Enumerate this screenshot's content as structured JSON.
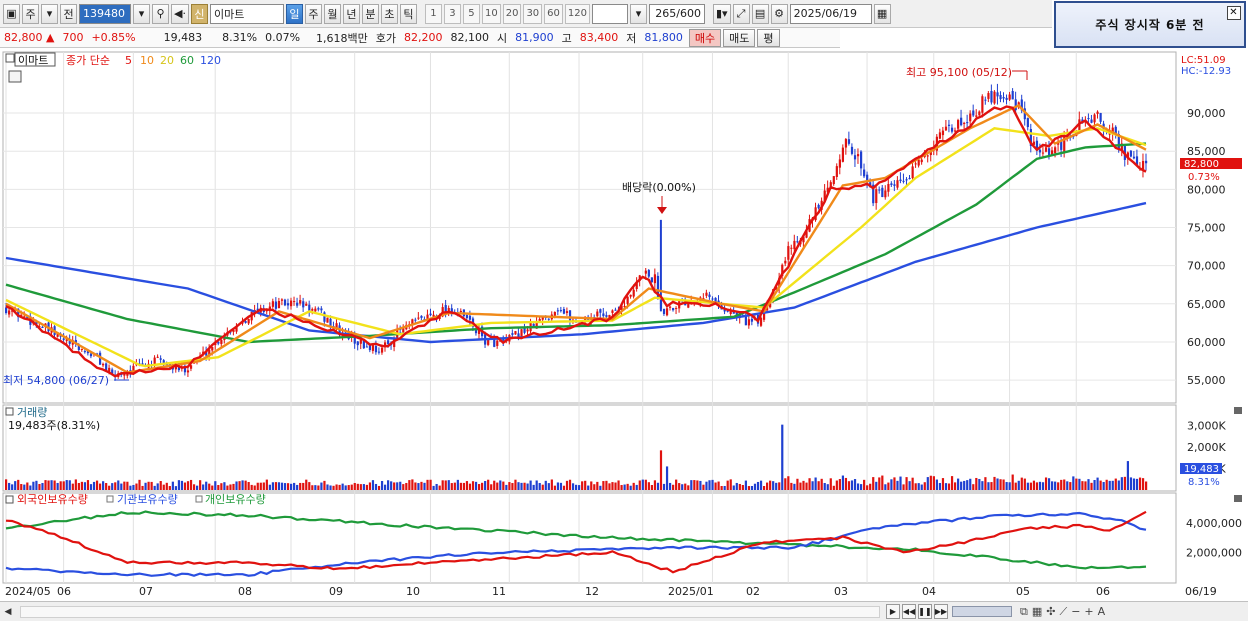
{
  "toolbar": {
    "cycle_label": "주",
    "prev_label": "전",
    "code": "139480",
    "name": "이마트",
    "sin_label": "신",
    "periods": [
      "일",
      "주",
      "월",
      "년",
      "분",
      "초",
      "틱"
    ],
    "active_period": "일",
    "intervals": [
      "1",
      "3",
      "5",
      "10",
      "20",
      "30",
      "60",
      "120"
    ],
    "count": "265/600",
    "date": "2025/06/19"
  },
  "notice": {
    "text": "주식 장시작 6분 전"
  },
  "info": {
    "price": "82,800",
    "change": "700",
    "change_pct": "+0.85%",
    "volume": "19,483",
    "turnover": "8.31%",
    "vol_pct": "0.07%",
    "amount": "1,618백만",
    "quote_label": "호가",
    "ask": "82,200",
    "bid": "82,100",
    "open_label": "시",
    "open": "81,900",
    "high_label": "고",
    "high": "83,400",
    "low_label": "저",
    "low": "81,800",
    "buy_label": "매수",
    "sell_label": "매도",
    "extra_label": "평"
  },
  "price_panel": {
    "name": "이마트",
    "legend_main": "종가 단순",
    "ma_periods": [
      "5",
      "10",
      "20",
      "60",
      "120"
    ],
    "lc_label": "LC:51.09",
    "hc_label": "HC:-12.93",
    "high_annotation": "최고 95,100 (05/12)",
    "low_annotation": "최저 54,800 (06/27)",
    "div_annotation": "배당락(0.00%)",
    "price_tag": "82,800",
    "price_tag_pct": "0.73%"
  },
  "volume_panel": {
    "title": "거래량",
    "value_label": "19,483주(8.31%)",
    "tag": "19,483",
    "tag_pct": "8.31%"
  },
  "holdings_panel": {
    "series": [
      "외국인보유수량",
      "기관보유수량",
      "개인보유수량"
    ]
  },
  "x_axis": {
    "labels": [
      "2024/05",
      "06",
      "07",
      "08",
      "09",
      "10",
      "11",
      "12",
      "2025/01",
      "02",
      "03",
      "04",
      "05",
      "06"
    ],
    "right_label": "06/19"
  },
  "chart_data": [
    {
      "type": "candlestick",
      "title": "이마트",
      "series_names": [
        "5",
        "10",
        "20",
        "60",
        "120"
      ],
      "ylim": [
        52000,
        98000
      ],
      "yticks": [
        55000,
        60000,
        65000,
        70000,
        75000,
        80000,
        85000,
        90000
      ],
      "keypoints": [
        [
          0,
          64500
        ],
        [
          10,
          62500
        ],
        [
          20,
          60000
        ],
        [
          30,
          58000
        ],
        [
          35,
          55500
        ],
        [
          42,
          56500
        ],
        [
          50,
          57500
        ],
        [
          58,
          56300
        ],
        [
          64,
          58000
        ],
        [
          72,
          61000
        ],
        [
          80,
          63500
        ],
        [
          88,
          64800
        ],
        [
          96,
          65200
        ],
        [
          104,
          63500
        ],
        [
          110,
          61500
        ],
        [
          118,
          59500
        ],
        [
          124,
          59000
        ],
        [
          130,
          61500
        ],
        [
          138,
          63200
        ],
        [
          146,
          64500
        ],
        [
          152,
          63000
        ],
        [
          158,
          60200
        ],
        [
          164,
          59800
        ],
        [
          170,
          61300
        ],
        [
          176,
          62700
        ],
        [
          182,
          64500
        ],
        [
          188,
          62500
        ],
        [
          194,
          63500
        ],
        [
          200,
          63800
        ],
        [
          206,
          65800
        ],
        [
          210,
          69200
        ],
        [
          214,
          68200
        ],
        [
          216,
          64200
        ],
        [
          224,
          65400
        ],
        [
          230,
          66400
        ],
        [
          236,
          64600
        ],
        [
          244,
          62800
        ],
        [
          248,
          62500
        ],
        [
          252,
          66000
        ],
        [
          258,
          72000
        ],
        [
          266,
          76200
        ],
        [
          272,
          80500
        ],
        [
          276,
          86200
        ],
        [
          282,
          83500
        ],
        [
          286,
          79000
        ],
        [
          292,
          80000
        ],
        [
          298,
          81500
        ],
        [
          304,
          85300
        ],
        [
          310,
          87300
        ],
        [
          318,
          89800
        ],
        [
          326,
          92700
        ],
        [
          331,
          92300
        ],
        [
          334,
          90800
        ],
        [
          340,
          84500
        ],
        [
          346,
          84800
        ],
        [
          352,
          87500
        ],
        [
          356,
          89300
        ],
        [
          360,
          89300
        ],
        [
          366,
          86800
        ],
        [
          370,
          84000
        ],
        [
          376,
          82800
        ]
      ],
      "ma5": [
        [
          0,
          64800
        ],
        [
          35,
          55500
        ],
        [
          60,
          57000
        ],
        [
          85,
          64500
        ],
        [
          110,
          61200
        ],
        [
          124,
          59200
        ],
        [
          146,
          64200
        ],
        [
          164,
          60000
        ],
        [
          200,
          63200
        ],
        [
          210,
          68800
        ],
        [
          218,
          65000
        ],
        [
          236,
          64800
        ],
        [
          248,
          63000
        ],
        [
          272,
          80000
        ],
        [
          286,
          80500
        ],
        [
          310,
          86500
        ],
        [
          331,
          91500
        ],
        [
          340,
          85000
        ],
        [
          356,
          88800
        ],
        [
          376,
          82500
        ]
      ],
      "ma10": [
        [
          0,
          65000
        ],
        [
          40,
          56000
        ],
        [
          64,
          57500
        ],
        [
          90,
          64000
        ],
        [
          120,
          60500
        ],
        [
          146,
          63800
        ],
        [
          200,
          63000
        ],
        [
          212,
          67000
        ],
        [
          236,
          65000
        ],
        [
          250,
          64000
        ],
        [
          276,
          80500
        ],
        [
          290,
          81500
        ],
        [
          318,
          88000
        ],
        [
          334,
          91000
        ],
        [
          346,
          86000
        ],
        [
          360,
          88500
        ],
        [
          376,
          85200
        ]
      ],
      "ma20": [
        [
          0,
          65500
        ],
        [
          45,
          56800
        ],
        [
          70,
          58000
        ],
        [
          100,
          64000
        ],
        [
          130,
          61000
        ],
        [
          160,
          62500
        ],
        [
          200,
          62800
        ],
        [
          214,
          65800
        ],
        [
          250,
          64500
        ],
        [
          282,
          75000
        ],
        [
          300,
          81500
        ],
        [
          326,
          88000
        ],
        [
          344,
          87000
        ],
        [
          360,
          88000
        ],
        [
          376,
          85800
        ]
      ],
      "ma60": [
        [
          0,
          67500
        ],
        [
          40,
          63000
        ],
        [
          80,
          60000
        ],
        [
          120,
          60800
        ],
        [
          160,
          61800
        ],
        [
          200,
          62200
        ],
        [
          240,
          63300
        ],
        [
          260,
          66500
        ],
        [
          290,
          71500
        ],
        [
          320,
          78000
        ],
        [
          340,
          84000
        ],
        [
          356,
          85500
        ],
        [
          376,
          86000
        ]
      ],
      "ma120": [
        [
          0,
          71000
        ],
        [
          60,
          67000
        ],
        [
          100,
          61500
        ],
        [
          140,
          60000
        ],
        [
          190,
          61000
        ],
        [
          230,
          62500
        ],
        [
          260,
          64500
        ],
        [
          300,
          70500
        ],
        [
          340,
          75000
        ],
        [
          376,
          78200
        ]
      ]
    },
    {
      "type": "bar",
      "title": "거래량",
      "ylim": [
        0,
        3500
      ],
      "yticks": [
        1000,
        2000,
        3000
      ],
      "spikes": [
        [
          216,
          1850
        ],
        [
          218,
          1100
        ],
        [
          256,
          3050
        ],
        [
          370,
          1350
        ]
      ]
    },
    {
      "type": "line",
      "series_names": [
        "외국인보유수량",
        "기관보유수량",
        "개인보유수량"
      ],
      "ylim": [
        0,
        5200000
      ],
      "yticks": [
        2000000,
        4000000
      ],
      "foreign": [
        [
          0,
          4200000
        ],
        [
          15,
          3300000
        ],
        [
          40,
          1300000
        ],
        [
          80,
          1300000
        ],
        [
          110,
          900000
        ],
        [
          140,
          1300000
        ],
        [
          200,
          2000000
        ],
        [
          220,
          700000
        ],
        [
          250,
          2700000
        ],
        [
          276,
          3000000
        ],
        [
          296,
          2000000
        ],
        [
          316,
          2700000
        ],
        [
          336,
          3600000
        ],
        [
          356,
          3800000
        ],
        [
          364,
          3500000
        ],
        [
          376,
          4700000
        ]
      ],
      "institution": [
        [
          0,
          900000
        ],
        [
          40,
          500000
        ],
        [
          80,
          500000
        ],
        [
          120,
          1400000
        ],
        [
          160,
          2000000
        ],
        [
          220,
          2300000
        ],
        [
          260,
          2300000
        ],
        [
          290,
          3800000
        ],
        [
          330,
          4500000
        ],
        [
          356,
          4600000
        ],
        [
          370,
          4000000
        ],
        [
          376,
          3500000
        ]
      ],
      "individual": [
        [
          0,
          3600000
        ],
        [
          40,
          4700000
        ],
        [
          80,
          4500000
        ],
        [
          140,
          3700000
        ],
        [
          200,
          3000000
        ],
        [
          250,
          2600000
        ],
        [
          300,
          2200000
        ],
        [
          340,
          1300000
        ],
        [
          360,
          900000
        ],
        [
          376,
          1100000
        ]
      ]
    }
  ],
  "colors": {
    "up": "#e0120f",
    "down": "#1e3fd0",
    "ma5": "#e0120f",
    "ma10": "#f08a1a",
    "ma20": "#f2e21b",
    "ma60": "#1f9a3a",
    "ma120": "#2a4fe0"
  }
}
